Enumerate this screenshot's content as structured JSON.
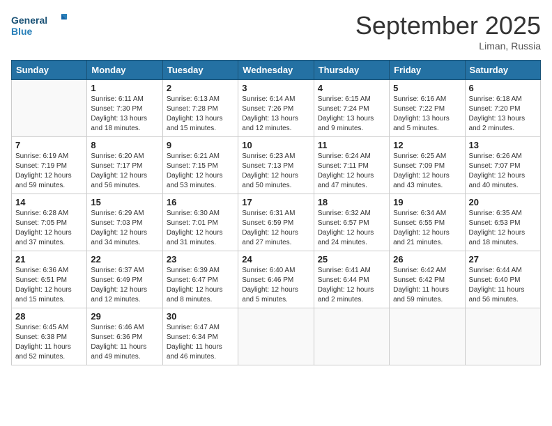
{
  "header": {
    "logo_general": "General",
    "logo_blue": "Blue",
    "month_year": "September 2025",
    "location": "Liman, Russia"
  },
  "columns": [
    "Sunday",
    "Monday",
    "Tuesday",
    "Wednesday",
    "Thursday",
    "Friday",
    "Saturday"
  ],
  "weeks": [
    [
      {
        "day": "",
        "sunrise": "",
        "sunset": "",
        "daylight": ""
      },
      {
        "day": "1",
        "sunrise": "Sunrise: 6:11 AM",
        "sunset": "Sunset: 7:30 PM",
        "daylight": "Daylight: 13 hours and 18 minutes."
      },
      {
        "day": "2",
        "sunrise": "Sunrise: 6:13 AM",
        "sunset": "Sunset: 7:28 PM",
        "daylight": "Daylight: 13 hours and 15 minutes."
      },
      {
        "day": "3",
        "sunrise": "Sunrise: 6:14 AM",
        "sunset": "Sunset: 7:26 PM",
        "daylight": "Daylight: 13 hours and 12 minutes."
      },
      {
        "day": "4",
        "sunrise": "Sunrise: 6:15 AM",
        "sunset": "Sunset: 7:24 PM",
        "daylight": "Daylight: 13 hours and 9 minutes."
      },
      {
        "day": "5",
        "sunrise": "Sunrise: 6:16 AM",
        "sunset": "Sunset: 7:22 PM",
        "daylight": "Daylight: 13 hours and 5 minutes."
      },
      {
        "day": "6",
        "sunrise": "Sunrise: 6:18 AM",
        "sunset": "Sunset: 7:20 PM",
        "daylight": "Daylight: 13 hours and 2 minutes."
      }
    ],
    [
      {
        "day": "7",
        "sunrise": "Sunrise: 6:19 AM",
        "sunset": "Sunset: 7:19 PM",
        "daylight": "Daylight: 12 hours and 59 minutes."
      },
      {
        "day": "8",
        "sunrise": "Sunrise: 6:20 AM",
        "sunset": "Sunset: 7:17 PM",
        "daylight": "Daylight: 12 hours and 56 minutes."
      },
      {
        "day": "9",
        "sunrise": "Sunrise: 6:21 AM",
        "sunset": "Sunset: 7:15 PM",
        "daylight": "Daylight: 12 hours and 53 minutes."
      },
      {
        "day": "10",
        "sunrise": "Sunrise: 6:23 AM",
        "sunset": "Sunset: 7:13 PM",
        "daylight": "Daylight: 12 hours and 50 minutes."
      },
      {
        "day": "11",
        "sunrise": "Sunrise: 6:24 AM",
        "sunset": "Sunset: 7:11 PM",
        "daylight": "Daylight: 12 hours and 47 minutes."
      },
      {
        "day": "12",
        "sunrise": "Sunrise: 6:25 AM",
        "sunset": "Sunset: 7:09 PM",
        "daylight": "Daylight: 12 hours and 43 minutes."
      },
      {
        "day": "13",
        "sunrise": "Sunrise: 6:26 AM",
        "sunset": "Sunset: 7:07 PM",
        "daylight": "Daylight: 12 hours and 40 minutes."
      }
    ],
    [
      {
        "day": "14",
        "sunrise": "Sunrise: 6:28 AM",
        "sunset": "Sunset: 7:05 PM",
        "daylight": "Daylight: 12 hours and 37 minutes."
      },
      {
        "day": "15",
        "sunrise": "Sunrise: 6:29 AM",
        "sunset": "Sunset: 7:03 PM",
        "daylight": "Daylight: 12 hours and 34 minutes."
      },
      {
        "day": "16",
        "sunrise": "Sunrise: 6:30 AM",
        "sunset": "Sunset: 7:01 PM",
        "daylight": "Daylight: 12 hours and 31 minutes."
      },
      {
        "day": "17",
        "sunrise": "Sunrise: 6:31 AM",
        "sunset": "Sunset: 6:59 PM",
        "daylight": "Daylight: 12 hours and 27 minutes."
      },
      {
        "day": "18",
        "sunrise": "Sunrise: 6:32 AM",
        "sunset": "Sunset: 6:57 PM",
        "daylight": "Daylight: 12 hours and 24 minutes."
      },
      {
        "day": "19",
        "sunrise": "Sunrise: 6:34 AM",
        "sunset": "Sunset: 6:55 PM",
        "daylight": "Daylight: 12 hours and 21 minutes."
      },
      {
        "day": "20",
        "sunrise": "Sunrise: 6:35 AM",
        "sunset": "Sunset: 6:53 PM",
        "daylight": "Daylight: 12 hours and 18 minutes."
      }
    ],
    [
      {
        "day": "21",
        "sunrise": "Sunrise: 6:36 AM",
        "sunset": "Sunset: 6:51 PM",
        "daylight": "Daylight: 12 hours and 15 minutes."
      },
      {
        "day": "22",
        "sunrise": "Sunrise: 6:37 AM",
        "sunset": "Sunset: 6:49 PM",
        "daylight": "Daylight: 12 hours and 12 minutes."
      },
      {
        "day": "23",
        "sunrise": "Sunrise: 6:39 AM",
        "sunset": "Sunset: 6:47 PM",
        "daylight": "Daylight: 12 hours and 8 minutes."
      },
      {
        "day": "24",
        "sunrise": "Sunrise: 6:40 AM",
        "sunset": "Sunset: 6:46 PM",
        "daylight": "Daylight: 12 hours and 5 minutes."
      },
      {
        "day": "25",
        "sunrise": "Sunrise: 6:41 AM",
        "sunset": "Sunset: 6:44 PM",
        "daylight": "Daylight: 12 hours and 2 minutes."
      },
      {
        "day": "26",
        "sunrise": "Sunrise: 6:42 AM",
        "sunset": "Sunset: 6:42 PM",
        "daylight": "Daylight: 11 hours and 59 minutes."
      },
      {
        "day": "27",
        "sunrise": "Sunrise: 6:44 AM",
        "sunset": "Sunset: 6:40 PM",
        "daylight": "Daylight: 11 hours and 56 minutes."
      }
    ],
    [
      {
        "day": "28",
        "sunrise": "Sunrise: 6:45 AM",
        "sunset": "Sunset: 6:38 PM",
        "daylight": "Daylight: 11 hours and 52 minutes."
      },
      {
        "day": "29",
        "sunrise": "Sunrise: 6:46 AM",
        "sunset": "Sunset: 6:36 PM",
        "daylight": "Daylight: 11 hours and 49 minutes."
      },
      {
        "day": "30",
        "sunrise": "Sunrise: 6:47 AM",
        "sunset": "Sunset: 6:34 PM",
        "daylight": "Daylight: 11 hours and 46 minutes."
      },
      {
        "day": "",
        "sunrise": "",
        "sunset": "",
        "daylight": ""
      },
      {
        "day": "",
        "sunrise": "",
        "sunset": "",
        "daylight": ""
      },
      {
        "day": "",
        "sunrise": "",
        "sunset": "",
        "daylight": ""
      },
      {
        "day": "",
        "sunrise": "",
        "sunset": "",
        "daylight": ""
      }
    ]
  ]
}
